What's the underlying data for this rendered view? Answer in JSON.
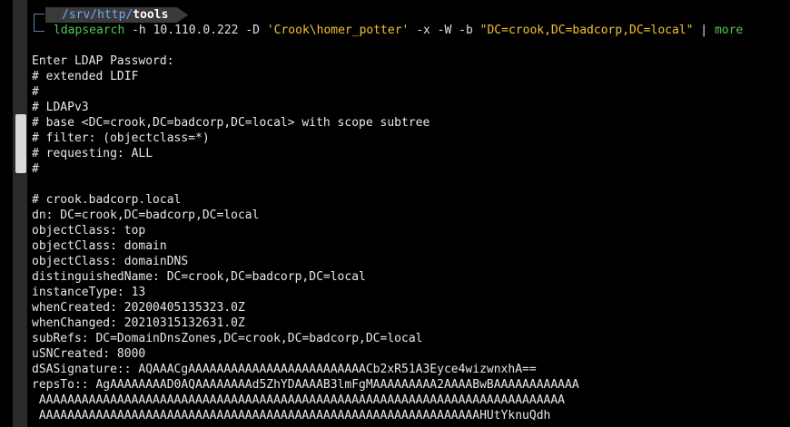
{
  "prompt": {
    "path_prefix": "/srv/http/",
    "path_last": "tools"
  },
  "command": {
    "program": "ldapsearch",
    "args1": " -h 10.110.0.222 -D ",
    "bind_dn": "'Crook\\homer_potter'",
    "args2": " -x -W -b ",
    "base": "\"DC=crook,DC=badcorp,DC=local\"",
    "pipe": " | ",
    "pager": "more"
  },
  "output_lines": [
    "Enter LDAP Password:",
    "# extended LDIF",
    "#",
    "# LDAPv3",
    "# base <DC=crook,DC=badcorp,DC=local> with scope subtree",
    "# filter: (objectclass=*)",
    "# requesting: ALL",
    "#",
    "",
    "# crook.badcorp.local",
    "dn: DC=crook,DC=badcorp,DC=local",
    "objectClass: top",
    "objectClass: domain",
    "objectClass: domainDNS",
    "distinguishedName: DC=crook,DC=badcorp,DC=local",
    "instanceType: 13",
    "whenCreated: 20200405135323.0Z",
    "whenChanged: 20210315132631.0Z",
    "subRefs: DC=DomainDnsZones,DC=crook,DC=badcorp,DC=local",
    "uSNCreated: 8000",
    "dSASignature:: AQAAACgAAAAAAAAAAAAAAAAAAAAAAAAACb2xR51A3Eyce4wizwnxhA==",
    "repsTo:: AgAAAAAAAAD0AQAAAAAAAAd5ZhYDAAAAB3lmFgMAAAAAAAAA2AAAABwBAAAAAAAAAAAA",
    " AAAAAAAAAAAAAAAAAAAAAAAAAAAAAAAAAAAAAAAAAAAAAAAAAAAAAAAAAAAAAAAAAAAAAAAAAA",
    " AAAAAAAAAAAAAAAAAAAAAAAAAAAAAAAAAAAAAAAAAAAAAAAAAAAAAAAAAAAAAAHUtYknuQdh"
  ]
}
